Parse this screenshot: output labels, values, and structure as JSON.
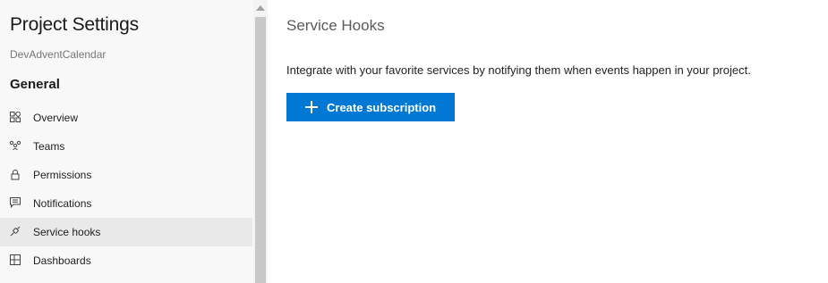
{
  "sidebar": {
    "title": "Project Settings",
    "project_name": "DevAdventCalendar",
    "section": "General",
    "items": [
      {
        "label": "Overview",
        "icon": "overview-icon",
        "selected": false
      },
      {
        "label": "Teams",
        "icon": "teams-icon",
        "selected": false
      },
      {
        "label": "Permissions",
        "icon": "lock-icon",
        "selected": false
      },
      {
        "label": "Notifications",
        "icon": "notification-icon",
        "selected": false
      },
      {
        "label": "Service hooks",
        "icon": "service-hooks-icon",
        "selected": true
      },
      {
        "label": "Dashboards",
        "icon": "dashboard-icon",
        "selected": false
      }
    ]
  },
  "main": {
    "title": "Service Hooks",
    "description": "Integrate with your favorite services by notifying them when events happen in your project.",
    "create_button": "Create subscription"
  },
  "colors": {
    "accent": "#0078d4",
    "selected_bg": "#e9e9e9",
    "sidebar_bg": "#f8f8f8"
  }
}
